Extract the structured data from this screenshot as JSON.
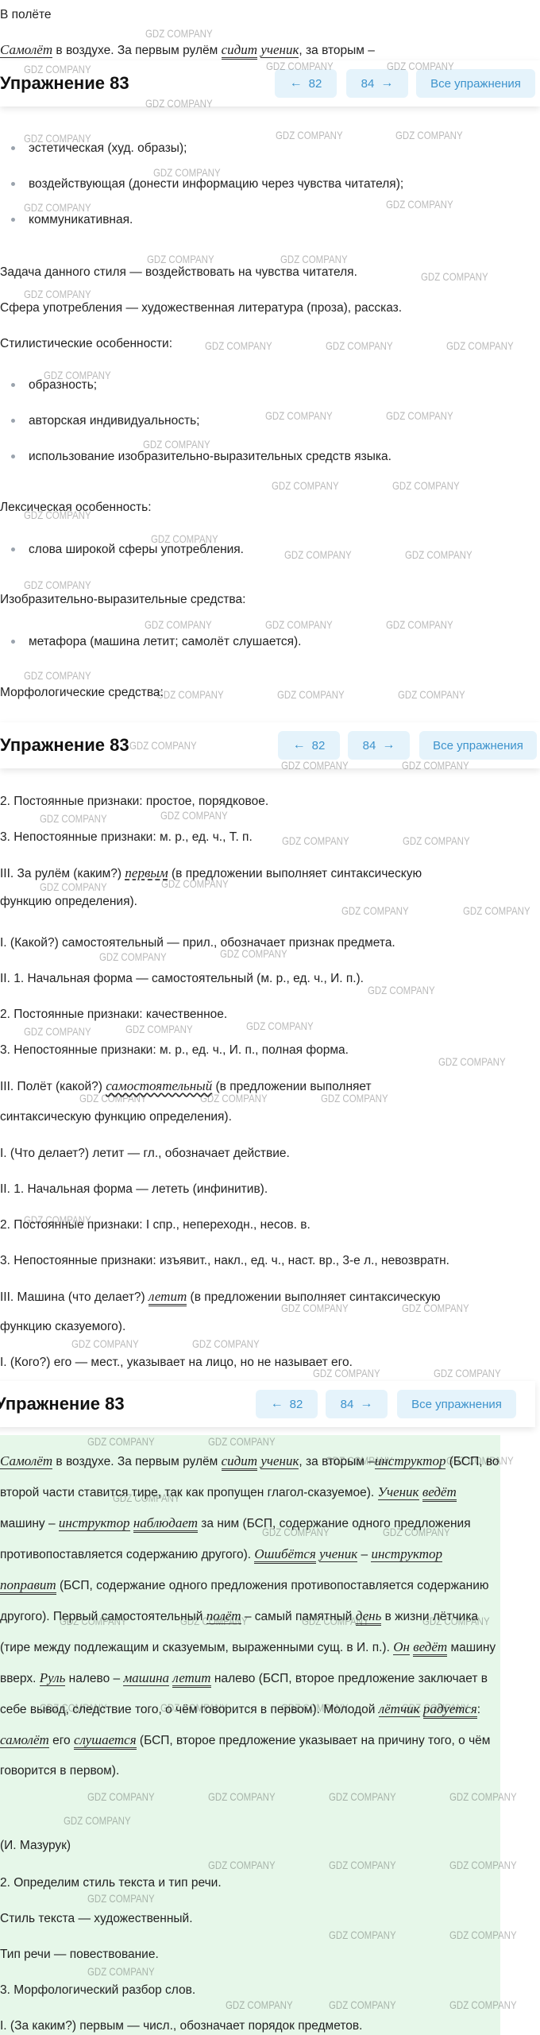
{
  "page": {
    "header_text": "В полёте",
    "top_line_parts": [
      "Самолёт",
      " в воздухе. За первым рулём ",
      "сидит",
      " ",
      "ученик",
      ", за вторым –"
    ]
  },
  "nav": {
    "title": "Упражнение 83",
    "prev_label": "82",
    "next_label": "84",
    "all_label": "Все упражнения",
    "prev_icon": "arrow-left-icon",
    "next_icon": "arrow-right-icon"
  },
  "style_functions": [
    "эстетическая (худ. образы);",
    "воздействующая (донести информацию через чувства читателя);",
    "коммуникативная."
  ],
  "style_task": "Задача данного стиля — воздействовать на чувства читателя.",
  "style_sphere": "Сфера употребления — художественная литература (проза), рассказ.",
  "stylistic_heading": "Стилистические особенности:",
  "stylistic_items": [
    "образность;",
    "авторская индивидуальность;",
    "использование изобразительно-выразительных средств языка."
  ],
  "lexical_heading": "Лексическая особенность:",
  "lexical_items": [
    "слова широкой сферы употребления."
  ],
  "expressive_heading": "Изобразительно-выразительные средства:",
  "expressive_items": [
    "метафора (машина летит; самолёт слушается)."
  ],
  "morph_heading": "Морфологические средства:",
  "analysis": {
    "first_const": "2. Постоянные признаки: простое, порядковое.",
    "first_nonconst": "3. Непостоянные признаки: м. р., ед. ч., Т. п.",
    "first_role_a": "III. За рулём (каким?) ",
    "first_role_word": "первым",
    "first_role_b": " (в предложении выполняет синтаксическую",
    "first_role_c": "функцию определения).",
    "adj_1": "I. (Какой?) самостоятельный — прил., обозначает признак предмета.",
    "adj_2": "II. 1. Начальная форма — самостоятельный (м. р., ед. ч., И. п.).",
    "adj_3": "2. Постоянные признаки: качественное.",
    "adj_4": "3. Непостоянные признаки: м. р., ед. ч., И. п., полная форма.",
    "adj_5a": "III. Полёт (какой?) ",
    "adj_5word": "самостоятельный",
    "adj_5b": " (в предложении выполняет",
    "adj_5c": "синтаксическую функцию определения).",
    "verb_1": "I. (Что делает?) летит — гл., обозначает действие.",
    "verb_2": "II. 1. Начальная форма — лететь (инфинитив).",
    "verb_3": "2. Постоянные признаки: I спр., непереходн., несов. в.",
    "verb_4": "3. Непостоянные признаки: изъявит., накл., ед. ч., наст. вр., 3-е л., невозвратн.",
    "verb_5a": "III. Машина (что делает?) ",
    "verb_5word": "летит",
    "verb_5b": " (в предложении выполняет синтаксическую",
    "verb_5c": "функцию сказуемого).",
    "pron_1": "I. (Кого?) его — мест., указывает на лицо, но не называет его."
  },
  "answer": {
    "p1_a": "Самолёт",
    "p1_b": " в воздухе. За первым рулём ",
    "p1_c": "сидит",
    "p1_d": " ",
    "p1_e": "ученик",
    "p1_f": ", за вторым –",
    "p1_g": "инструктор",
    "p1_h": " (БСП, во второй части ставится тире, так как пропущен глагол-сказуемое). ",
    "p1_i": "Ученик",
    "p1_j": " ",
    "p1_k": "ведёт",
    "p1_l": " машину – ",
    "p1_m": "инструктор",
    "p1_n": " ",
    "p1_o": "наблюдает",
    "p1_p": " за ним (БСП, содержание одного предложения противопоставляется содержанию другого). ",
    "p1_q": "Ошибётся",
    "p1_r": " ",
    "p1_s": "ученик",
    "p1_t": " – ",
    "p1_u": "инструктор",
    "p1_v": " ",
    "p1_w": "поправит",
    "p1_x": " (БСП, содержание одного предложения противопоставляется содержанию другого). Первый самостоятельный ",
    "p1_y": "полёт",
    "p1_z": " – самый памятный ",
    "p1_aa": "день",
    "p1_ab": " в жизни лётчика (тире между подлежащим и сказуемым, выраженными сущ. в И. п.). ",
    "p1_ac": "Он",
    "p1_ad": " ",
    "p1_ae": "ведёт",
    "p1_af": " машину вверх. ",
    "p1_ag": "Руль",
    "p1_ah": " налево – ",
    "p1_ai": "машина",
    "p1_aj": " ",
    "p1_ak": "летит",
    "p1_al": " налево (БСП, второе предложение заключает в себе вывод, следствие того, о чём говорится в первом). Молодой ",
    "p1_am": "лётчик",
    "p1_an": " ",
    "p1_ao": "радуется",
    "p1_ap": ": ",
    "p1_aq": "самолёт",
    "p1_ar": " его ",
    "p1_as": "слушается",
    "p1_at": " (БСП, второе предложение указывает на причину того, о чём говорится в первом).",
    "author": "(И. Мазурук)",
    "task2": "2. Определим стиль текста и тип речи.",
    "style": "Стиль текста — художественный.",
    "speech_type": "Тип речи — повествование.",
    "task3": "3. Морфологический разбор слов.",
    "last": "I. (За каким?) первым — числ., обозначает порядок предметов."
  },
  "watermark": "GDZ COMPANY",
  "colors": {
    "accent": "#3d93cc",
    "button_bg": "#e5f3fb",
    "answer_bg": "#e6f7e9"
  }
}
